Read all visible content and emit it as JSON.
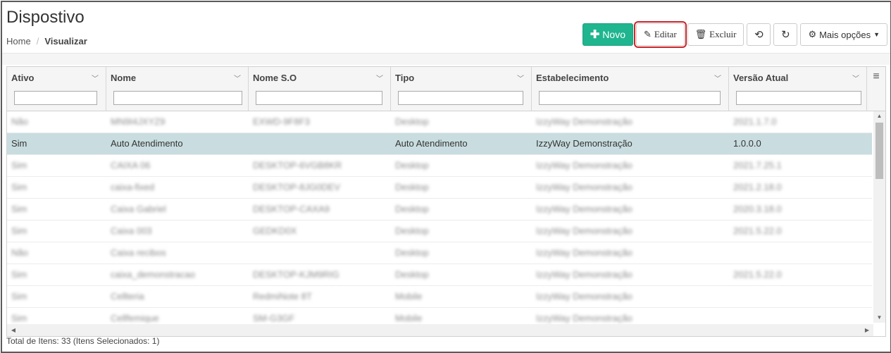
{
  "page": {
    "title": "Dispostivo"
  },
  "breadcrumb": {
    "home": "Home",
    "separator": "/",
    "current": "Visualizar"
  },
  "toolbar": {
    "novo": {
      "icon": "plus-icon",
      "label": "Novo"
    },
    "editar": {
      "icon": "pencil-icon",
      "label": "Editar"
    },
    "excluir": {
      "icon": "trash-icon",
      "label": "Excluir"
    },
    "sync_icon": "sync-icon",
    "refresh_icon": "refresh-icon",
    "mais": {
      "icon": "gear-icon",
      "label": "Mais opções"
    }
  },
  "grid": {
    "columns": [
      {
        "key": "ativo",
        "label": "Ativo"
      },
      {
        "key": "nome",
        "label": "Nome"
      },
      {
        "key": "nome_so",
        "label": "Nome S.O"
      },
      {
        "key": "tipo",
        "label": "Tipo"
      },
      {
        "key": "estabelecimento",
        "label": "Estabelecimento"
      },
      {
        "key": "versao",
        "label": "Versão Atual"
      }
    ],
    "rows": [
      {
        "ativo": "Não",
        "nome": "MN9I4JXYZ9",
        "nome_so": "EXWD-9F8F3",
        "tipo": "Desktop",
        "estabelecimento": "IzzyWay Demonstração",
        "versao": "2021.1.7.0",
        "blurred": true
      },
      {
        "ativo": "Sim",
        "nome": "Auto Atendimento",
        "nome_so": "",
        "tipo": "Auto Atendimento",
        "estabelecimento": "IzzyWay Demonstração",
        "versao": "1.0.0.0",
        "blurred": false,
        "selected": true
      },
      {
        "ativo": "Sim",
        "nome": "CAIXA 06",
        "nome_so": "DESKTOP-6VGB8KR",
        "tipo": "Desktop",
        "estabelecimento": "IzzyWay Demonstração",
        "versao": "2021.7.25.1",
        "blurred": true
      },
      {
        "ativo": "Sim",
        "nome": "caixa-fixed",
        "nome_so": "DESKTOP-8JG0DEV",
        "tipo": "Desktop",
        "estabelecimento": "IzzyWay Demonstração",
        "versao": "2021.2.18.0",
        "blurred": true
      },
      {
        "ativo": "Sim",
        "nome": "Caixa Gabriel",
        "nome_so": "DESKTOP-CAXA9",
        "tipo": "Desktop",
        "estabelecimento": "IzzyWay Demonstração",
        "versao": "2020.3.18.0",
        "blurred": true
      },
      {
        "ativo": "Sim",
        "nome": "Caixa 003",
        "nome_so": "GEDKD0X",
        "tipo": "Desktop",
        "estabelecimento": "IzzyWay Demonstração",
        "versao": "2021.5.22.0",
        "blurred": true
      },
      {
        "ativo": "Não",
        "nome": "Caixa recibos",
        "nome_so": "",
        "tipo": "Desktop",
        "estabelecimento": "IzzyWay Demonstração",
        "versao": "",
        "blurred": true
      },
      {
        "ativo": "Sim",
        "nome": "caixa_demonstracao",
        "nome_so": "DESKTOP-KJM9RIG",
        "tipo": "Desktop",
        "estabelecimento": "IzzyWay Demonstração",
        "versao": "2021.5.22.0",
        "blurred": true
      },
      {
        "ativo": "Sim",
        "nome": "Cellteria",
        "nome_so": "RedmiNote 8T",
        "tipo": "Mobile",
        "estabelecimento": "IzzyWay Demonstração",
        "versao": "",
        "blurred": true
      },
      {
        "ativo": "Sim",
        "nome": "Cellfemique",
        "nome_so": "SM-G3GF",
        "tipo": "Mobile",
        "estabelecimento": "IzzyWay Demonstração",
        "versao": "",
        "blurred": true
      }
    ]
  },
  "footer": {
    "text": "Total de Itens: 33 (Itens Selecionados: 1)"
  }
}
